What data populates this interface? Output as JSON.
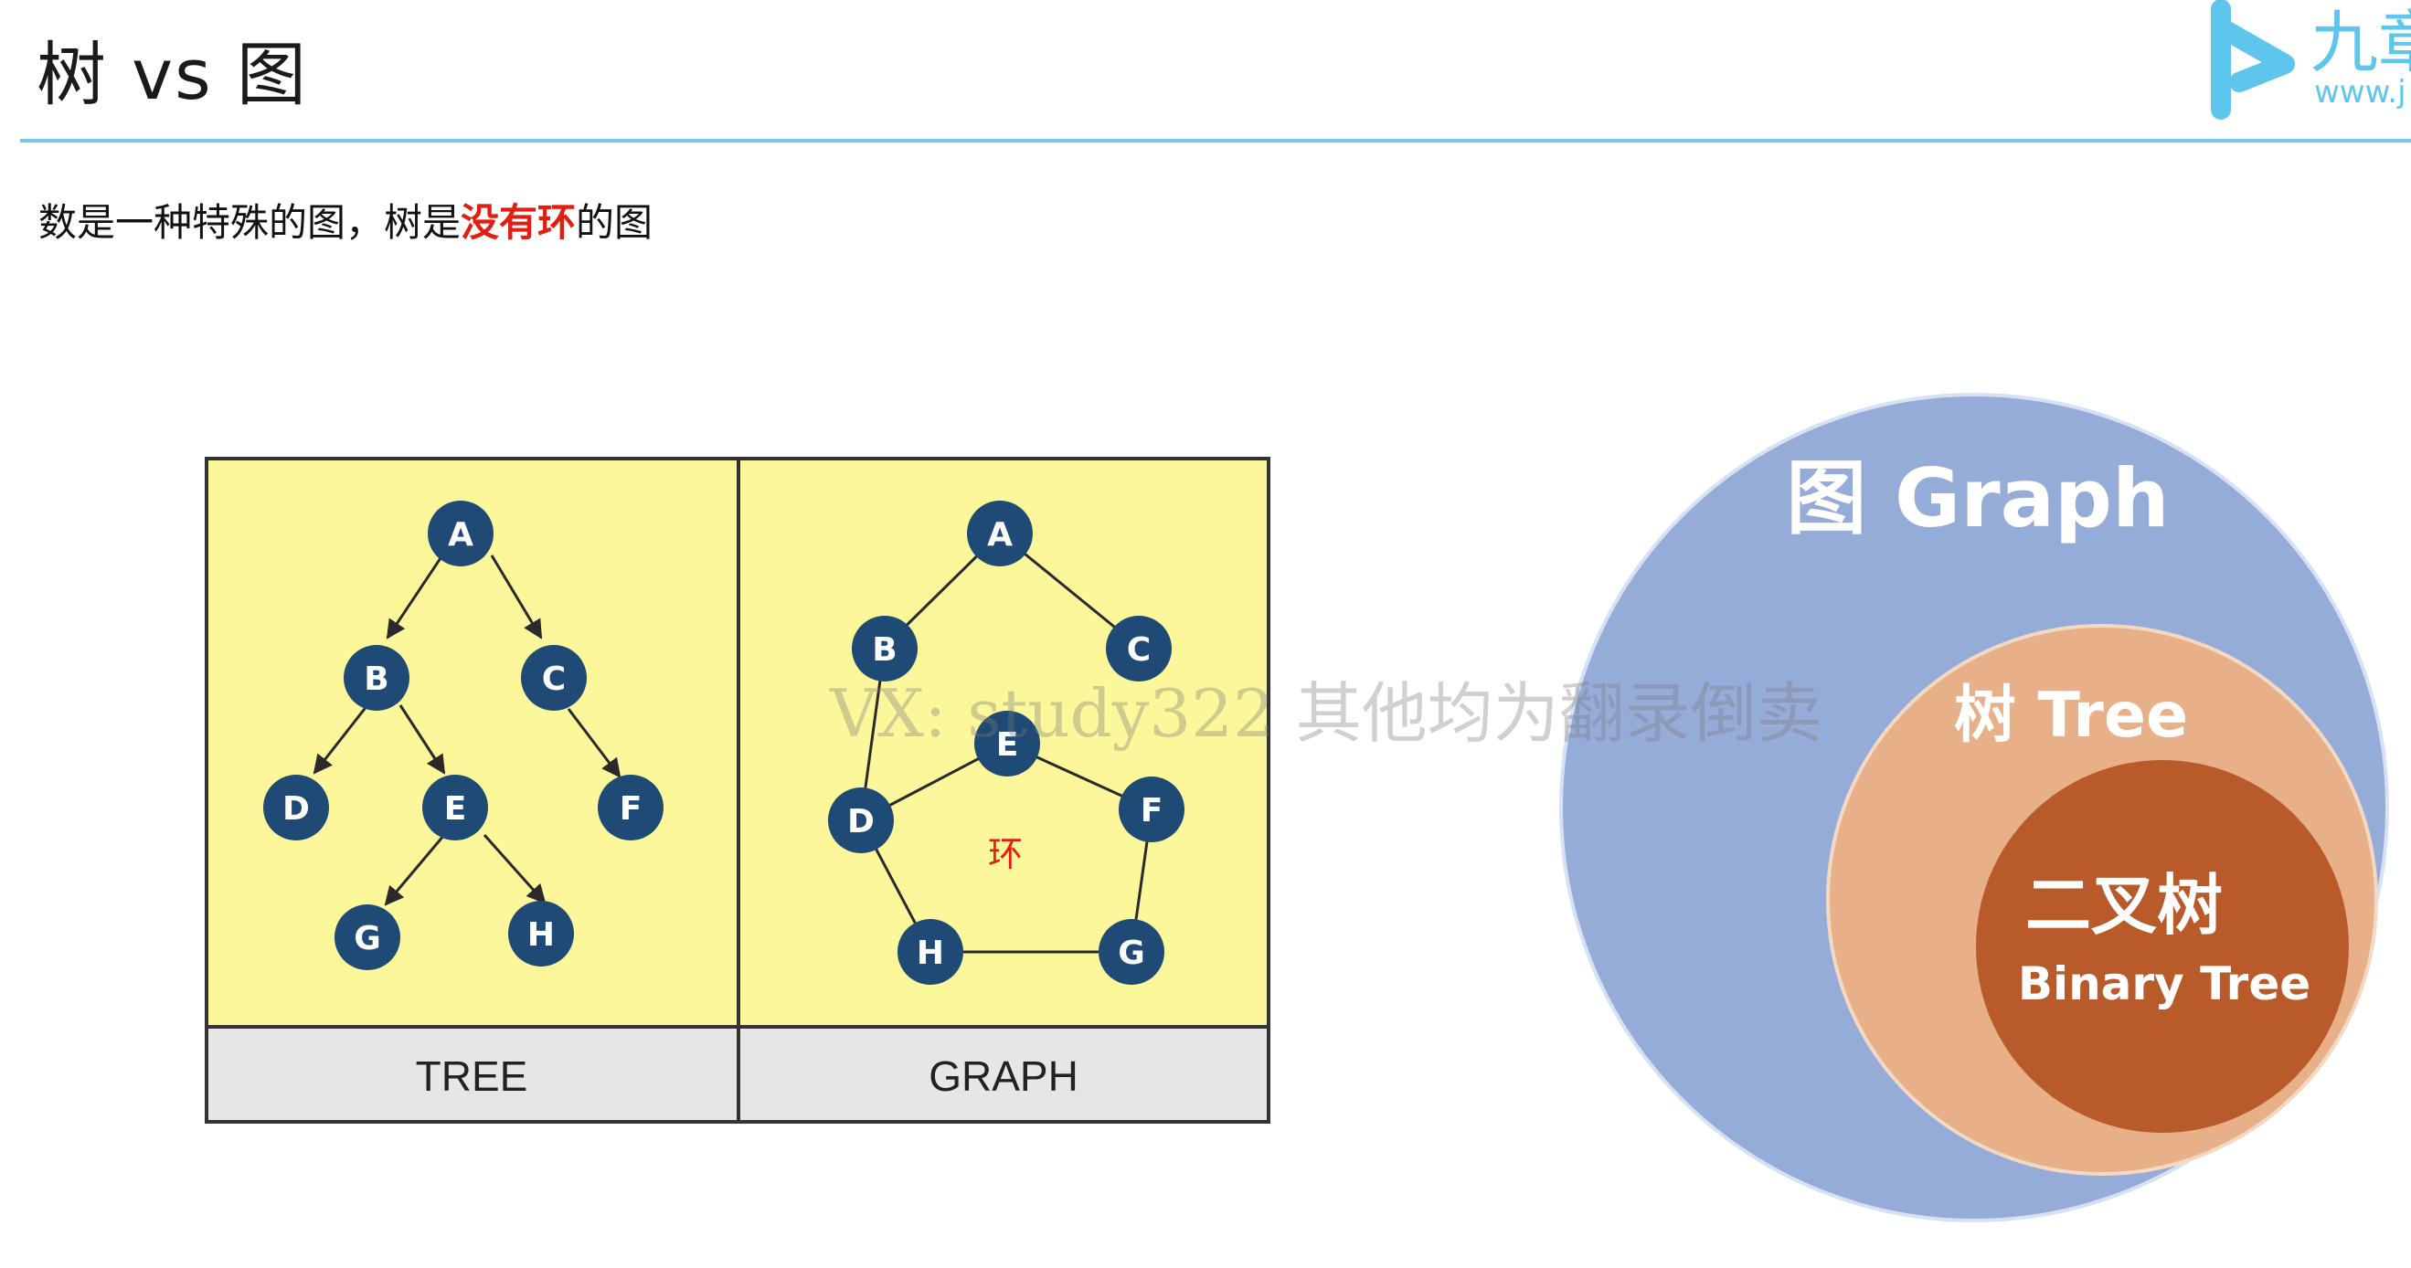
{
  "title": "树 vs 图",
  "subtitle": {
    "prefix": "数是一种特殊的图，树是",
    "highlight": "没有环",
    "suffix": "的图"
  },
  "tree_panel": {
    "caption": "TREE",
    "nodes": {
      "a": "A",
      "b": "B",
      "c": "C",
      "d": "D",
      "e": "E",
      "f": "F",
      "g": "G",
      "h": "H"
    }
  },
  "graph_panel": {
    "caption": "GRAPH",
    "cycle_label": "环",
    "nodes": {
      "a": "A",
      "b": "B",
      "c": "C",
      "d": "D",
      "e": "E",
      "f": "F",
      "g": "G",
      "h": "H"
    }
  },
  "venn": {
    "graph_label": "图 Graph",
    "tree_label": "树 Tree",
    "binary_label_cn": "二叉树",
    "binary_label_en": "Binary Tree"
  },
  "watermark": "VX: study322 其他均为翻录倒卖",
  "logo": {
    "text": "九章",
    "url_text": "www.j"
  },
  "colors": {
    "accent_rule": "#74c6ea",
    "highlight": "#e21d12",
    "panel_bg": "#fbf79a",
    "node": "#1f4a75",
    "graph_circle": "#95acd9",
    "tree_circle": "#e8b088",
    "binary_circle": "#b85a2a"
  }
}
